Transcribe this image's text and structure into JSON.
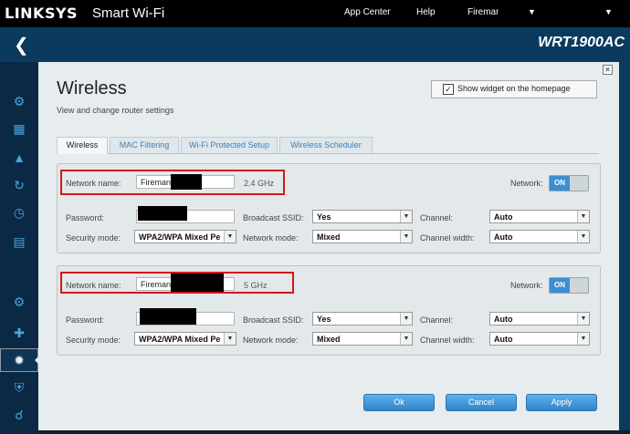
{
  "header": {
    "brand": "LINKSYS",
    "app_name": "Smart Wi-Fi",
    "links": [
      "App Center",
      "Help"
    ],
    "user": "Fireman"
  },
  "router_model": "WRT1900AC",
  "page": {
    "title": "Wireless",
    "subtitle": "View and change router settings",
    "widget_label": "Show widget on the homepage",
    "widget_checked": true
  },
  "tabs": [
    "Wireless",
    "MAC Filtering",
    "Wi-Fi Protected Setup",
    "Wireless Scheduler"
  ],
  "bands": [
    {
      "network_name_label": "Network name:",
      "network_name_value": "Fireman",
      "band": "2.4 GHz",
      "network_label": "Network:",
      "network_toggle": "ON",
      "password_label": "Password:",
      "security_mode_label": "Security mode:",
      "security_mode_value": "WPA2/WPA Mixed Pe",
      "broadcast_ssid_label": "Broadcast SSID:",
      "broadcast_ssid_value": "Yes",
      "network_mode_label": "Network mode:",
      "network_mode_value": "Mixed",
      "channel_label": "Channel:",
      "channel_value": "Auto",
      "channel_width_label": "Channel width:",
      "channel_width_value": "Auto"
    },
    {
      "network_name_label": "Network name:",
      "network_name_value": "Fireman",
      "band": "5 GHz",
      "network_label": "Network:",
      "network_toggle": "ON",
      "password_label": "Password:",
      "security_mode_label": "Security mode:",
      "security_mode_value": "WPA2/WPA Mixed Pe",
      "broadcast_ssid_label": "Broadcast SSID:",
      "broadcast_ssid_value": "Yes",
      "network_mode_label": "Network mode:",
      "network_mode_value": "Mixed",
      "channel_label": "Channel:",
      "channel_value": "Auto",
      "channel_width_label": "Channel width:",
      "channel_width_value": "Auto"
    }
  ],
  "buttons": {
    "ok": "Ok",
    "cancel": "Cancel",
    "apply": "Apply"
  },
  "sidebar_icons": [
    "network-map-icon",
    "calendar-icon",
    "warning-icon",
    "speed-icon",
    "clock-icon",
    "ethernet-icon",
    "gear-icon",
    "plus-icon",
    "wireless-icon",
    "shield-icon",
    "headset-icon"
  ],
  "colors": {
    "highlight": "#d4161c",
    "accent": "#3a8fd1",
    "header_bg": "#000000",
    "frame_bg": "#0a3a5d"
  }
}
